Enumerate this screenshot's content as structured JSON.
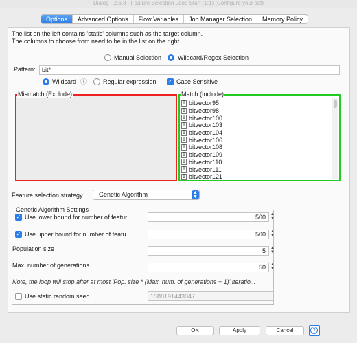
{
  "window": {
    "title": "Dialog - 2.6.8 - Feature Selection Loop Start (1:1) (Configure your set)"
  },
  "tabs": [
    "Options",
    "Advanced Options",
    "Flow Variables",
    "Job Manager Selection",
    "Memory Policy"
  ],
  "intro": {
    "line1": "The list on the left contains 'static' columns such as the target column.",
    "line2": "The columns to choose from need to be in the list on the right."
  },
  "selection_mode": {
    "manual": "Manual Selection",
    "wildcard": "Wildcard/Regex Selection",
    "selected": "wildcard"
  },
  "pattern": {
    "label": "Pattern:",
    "value": "bit*"
  },
  "pattern_type": {
    "wildcard": "Wildcard",
    "info": "ⓘ",
    "regex": "Regular expression",
    "case_sensitive": "Case Sensitive"
  },
  "mismatch": {
    "title": "Mismatch (Exclude)"
  },
  "match": {
    "title": "Match (Include)",
    "items": [
      "bitvector95",
      "bitvector98",
      "bitvector100",
      "bitvector103",
      "bitvector104",
      "bitvector106",
      "bitvector108",
      "bitvector109",
      "bitvector110",
      "bitvector111",
      "bitvector121"
    ],
    "type_glyph": "I"
  },
  "strategy": {
    "label": "Feature selection strategy",
    "value": "Genetic Algorithm"
  },
  "ga": {
    "title": "Genetic Algorithm Settings",
    "lower_label": "Use lower bound for number of featur...",
    "lower_value": "500",
    "upper_label": "Use upper bound for number of featu...",
    "upper_value": "500",
    "population_label": "Population size",
    "population_value": "5",
    "generations_label": "Max. number of generations",
    "generations_value": "50",
    "note": "Note, the loop will stop after at most 'Pop. size * (Max. num. of generations + 1)' iteratio...",
    "seed_label": "Use static random seed",
    "seed_value": "1588191443047"
  },
  "buttons": {
    "ok": "OK",
    "apply": "Apply",
    "cancel": "Cancel",
    "help": "?"
  },
  "colors": {
    "accent": "#2c7de8",
    "mismatch_border": "#e22222",
    "match_border": "#22cc22"
  }
}
